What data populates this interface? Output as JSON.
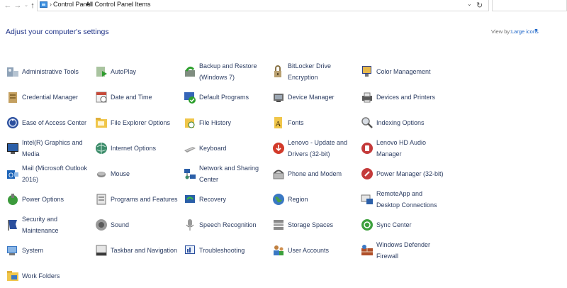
{
  "address_bar": {
    "crumbs": [
      "Control Panel",
      "All Control Panel Items"
    ]
  },
  "header": {
    "title": "Adjust your computer's settings",
    "view_by_label": "View by:",
    "view_by_value": "Large icons"
  },
  "items": [
    {
      "label": "Administrative Tools",
      "icon": "administrative-tools-icon"
    },
    {
      "label": "AutoPlay",
      "icon": "autoplay-icon"
    },
    {
      "label": "Backup and Restore (Windows 7)",
      "icon": "backup-restore-icon"
    },
    {
      "label": "BitLocker Drive Encryption",
      "icon": "bitlocker-icon"
    },
    {
      "label": "Color Management",
      "icon": "color-management-icon"
    },
    {
      "label": "Credential Manager",
      "icon": "credential-manager-icon"
    },
    {
      "label": "Date and Time",
      "icon": "date-time-icon"
    },
    {
      "label": "Default Programs",
      "icon": "default-programs-icon"
    },
    {
      "label": "Device Manager",
      "icon": "device-manager-icon"
    },
    {
      "label": "Devices and Printers",
      "icon": "devices-printers-icon"
    },
    {
      "label": "Ease of Access Center",
      "icon": "ease-of-access-icon"
    },
    {
      "label": "File Explorer Options",
      "icon": "file-explorer-options-icon"
    },
    {
      "label": "File History",
      "icon": "file-history-icon"
    },
    {
      "label": "Fonts",
      "icon": "fonts-icon"
    },
    {
      "label": "Indexing Options",
      "icon": "indexing-options-icon"
    },
    {
      "label": "Intel(R) Graphics and Media",
      "icon": "intel-graphics-icon"
    },
    {
      "label": "Internet Options",
      "icon": "internet-options-icon"
    },
    {
      "label": "Keyboard",
      "icon": "keyboard-icon"
    },
    {
      "label": "Lenovo - Update and Drivers (32-bit)",
      "icon": "lenovo-update-icon"
    },
    {
      "label": "Lenovo HD Audio Manager",
      "icon": "lenovo-audio-icon"
    },
    {
      "label": "Mail (Microsoft Outlook 2016)",
      "icon": "mail-icon"
    },
    {
      "label": "Mouse",
      "icon": "mouse-icon"
    },
    {
      "label": "Network and Sharing Center",
      "icon": "network-sharing-icon"
    },
    {
      "label": "Phone and Modem",
      "icon": "phone-modem-icon"
    },
    {
      "label": "Power Manager (32-bit)",
      "icon": "power-manager-icon"
    },
    {
      "label": "Power Options",
      "icon": "power-options-icon"
    },
    {
      "label": "Programs and Features",
      "icon": "programs-features-icon"
    },
    {
      "label": "Recovery",
      "icon": "recovery-icon"
    },
    {
      "label": "Region",
      "icon": "region-icon"
    },
    {
      "label": "RemoteApp and Desktop Connections",
      "icon": "remoteapp-icon"
    },
    {
      "label": "Security and Maintenance",
      "icon": "security-maintenance-icon"
    },
    {
      "label": "Sound",
      "icon": "sound-icon"
    },
    {
      "label": "Speech Recognition",
      "icon": "speech-recognition-icon"
    },
    {
      "label": "Storage Spaces",
      "icon": "storage-spaces-icon"
    },
    {
      "label": "Sync Center",
      "icon": "sync-center-icon"
    },
    {
      "label": "System",
      "icon": "system-icon"
    },
    {
      "label": "Taskbar and Navigation",
      "icon": "taskbar-navigation-icon"
    },
    {
      "label": "Troubleshooting",
      "icon": "troubleshooting-icon"
    },
    {
      "label": "User Accounts",
      "icon": "user-accounts-icon"
    },
    {
      "label": "Windows Defender Firewall",
      "icon": "firewall-icon"
    },
    {
      "label": "Work Folders",
      "icon": "work-folders-icon"
    }
  ]
}
